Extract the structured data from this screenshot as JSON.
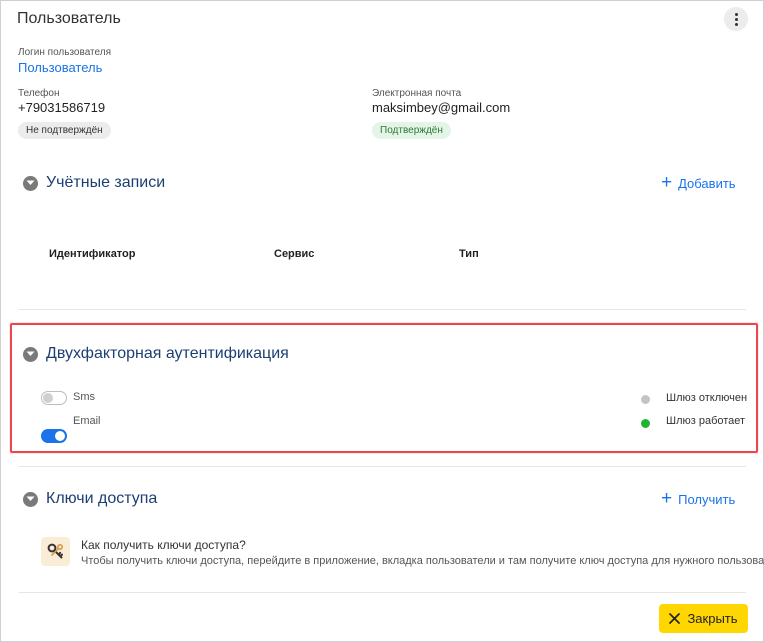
{
  "header": {
    "title": "Пользователь"
  },
  "user": {
    "login_label": "Логин пользователя",
    "login_value": "Пользователь",
    "phone_label": "Телефон",
    "phone_value": "+79031586719",
    "phone_status": "Не подтверждён",
    "email_label": "Электронная почта",
    "email_value": "maksimbey@gmail.com",
    "email_status": "Подтверждён"
  },
  "accounts": {
    "title": "Учётные записи",
    "add_label": "Добавить",
    "columns": [
      "Идентификатор",
      "Сервис",
      "Тип"
    ]
  },
  "twofa": {
    "title": "Двухфакторная аутентификация",
    "options": [
      {
        "label": "Sms",
        "enabled": false
      },
      {
        "label": "Email",
        "enabled": true
      }
    ],
    "gateways": [
      {
        "label": "Шлюз отключен",
        "color": "#c4c4c4"
      },
      {
        "label": "Шлюз работает",
        "color": "#1fb52f"
      }
    ]
  },
  "keys": {
    "title": "Ключи доступа",
    "get_label": "Получить",
    "question": "Как получить ключи доступа?",
    "hint": "Чтобы получить ключи доступа, перейдите в приложение, вкладка пользователи и там получите ключ доступа для нужного пользователя."
  },
  "footer": {
    "close_label": "Закрыть"
  },
  "colors": {
    "accent": "#1a73e8",
    "highlight": "#e8474e",
    "close_button": "#ffd600"
  }
}
